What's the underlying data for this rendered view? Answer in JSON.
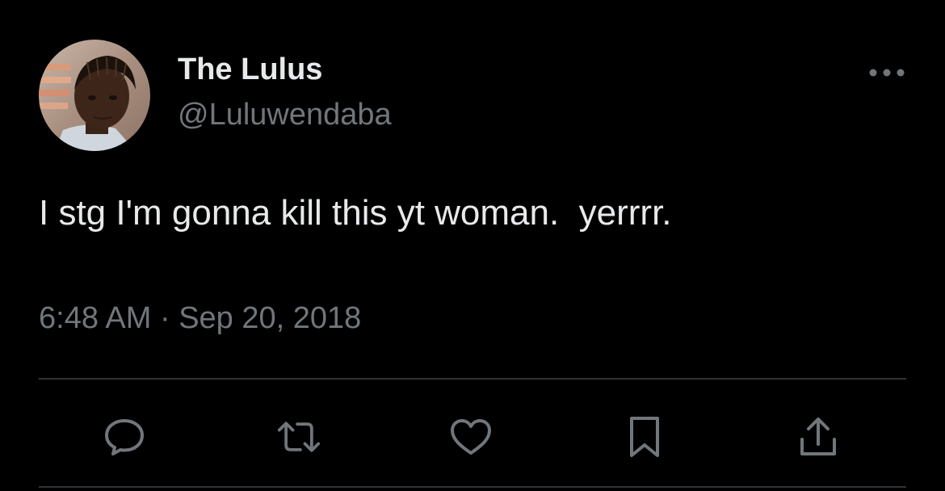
{
  "tweet": {
    "author": {
      "display_name": "The Lulus",
      "handle": "@Luluwendaba",
      "avatar_icon": "profile-photo"
    },
    "text": "I stg I'm gonna kill this yt woman.  yerrrr.",
    "timestamp": "6:48 AM · Sep 20, 2018"
  },
  "actions": [
    {
      "name": "reply",
      "icon": "speech-bubble-icon"
    },
    {
      "name": "retweet",
      "icon": "retweet-arrows-icon"
    },
    {
      "name": "like",
      "icon": "heart-icon"
    },
    {
      "name": "bookmark",
      "icon": "bookmark-icon"
    },
    {
      "name": "share",
      "icon": "share-upload-icon"
    }
  ],
  "more_menu_icon": "ellipsis-icon",
  "colors": {
    "background": "#000000",
    "primary_text": "#e7e9ea",
    "secondary_text": "#71767b",
    "divider": "#2f3336"
  }
}
